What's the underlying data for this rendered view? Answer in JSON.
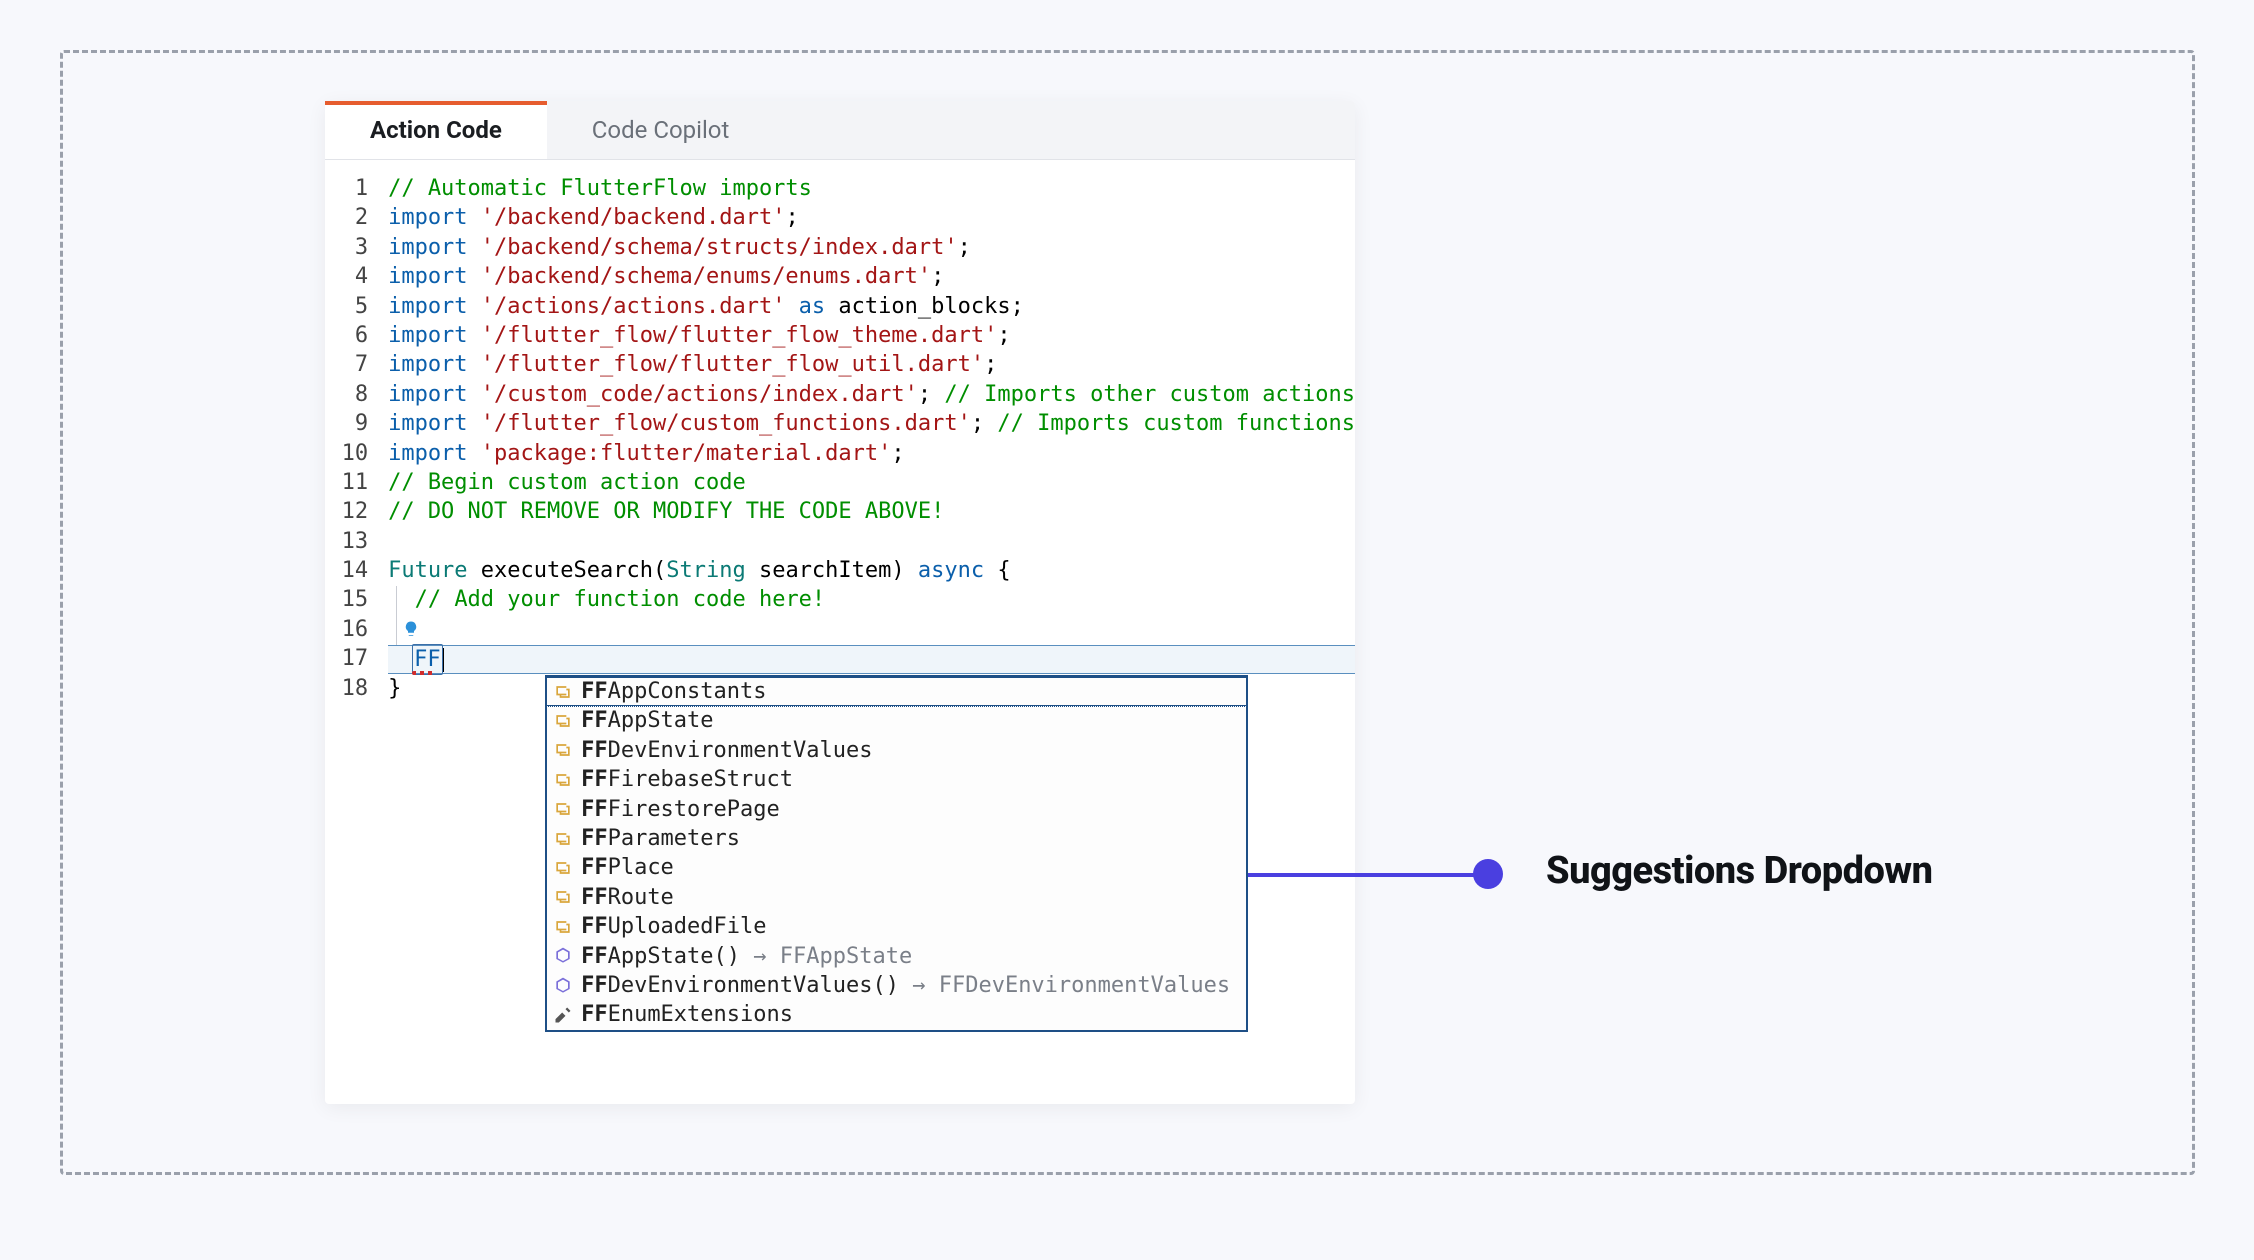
{
  "tabs": {
    "action_code": "Action Code",
    "code_copilot": "Code Copilot"
  },
  "callout": {
    "label": "Suggestions Dropdown"
  },
  "editor": {
    "typed": "FF",
    "lines": [
      {
        "n": "1",
        "segs": [
          {
            "c": "c-com",
            "t": "// Automatic FlutterFlow imports"
          }
        ]
      },
      {
        "n": "2",
        "segs": [
          {
            "c": "c-key",
            "t": "import "
          },
          {
            "c": "c-str",
            "t": "'/backend/backend.dart'"
          },
          {
            "c": "c-pun",
            "t": ";"
          }
        ]
      },
      {
        "n": "3",
        "segs": [
          {
            "c": "c-key",
            "t": "import "
          },
          {
            "c": "c-str",
            "t": "'/backend/schema/structs/index.dart'"
          },
          {
            "c": "c-pun",
            "t": ";"
          }
        ]
      },
      {
        "n": "4",
        "segs": [
          {
            "c": "c-key",
            "t": "import "
          },
          {
            "c": "c-str",
            "t": "'/backend/schema/enums/enums.dart'"
          },
          {
            "c": "c-pun",
            "t": ";"
          }
        ]
      },
      {
        "n": "5",
        "segs": [
          {
            "c": "c-key",
            "t": "import "
          },
          {
            "c": "c-str",
            "t": "'/actions/actions.dart'"
          },
          {
            "c": "c-key",
            "t": " as "
          },
          {
            "c": "c-id",
            "t": "action_blocks"
          },
          {
            "c": "c-pun",
            "t": ";"
          }
        ]
      },
      {
        "n": "6",
        "segs": [
          {
            "c": "c-key",
            "t": "import "
          },
          {
            "c": "c-str",
            "t": "'/flutter_flow/flutter_flow_theme.dart'"
          },
          {
            "c": "c-pun",
            "t": ";"
          }
        ]
      },
      {
        "n": "7",
        "segs": [
          {
            "c": "c-key",
            "t": "import "
          },
          {
            "c": "c-str",
            "t": "'/flutter_flow/flutter_flow_util.dart'"
          },
          {
            "c": "c-pun",
            "t": ";"
          }
        ]
      },
      {
        "n": "8",
        "segs": [
          {
            "c": "c-key",
            "t": "import "
          },
          {
            "c": "c-str",
            "t": "'/custom_code/actions/index.dart'"
          },
          {
            "c": "c-pun",
            "t": "; "
          },
          {
            "c": "c-com",
            "t": "// Imports other custom actions"
          }
        ]
      },
      {
        "n": "9",
        "segs": [
          {
            "c": "c-key",
            "t": "import "
          },
          {
            "c": "c-str",
            "t": "'/flutter_flow/custom_functions.dart'"
          },
          {
            "c": "c-pun",
            "t": "; "
          },
          {
            "c": "c-com",
            "t": "// Imports custom functions"
          }
        ]
      },
      {
        "n": "10",
        "segs": [
          {
            "c": "c-key",
            "t": "import "
          },
          {
            "c": "c-str",
            "t": "'package:flutter/material.dart'"
          },
          {
            "c": "c-pun",
            "t": ";"
          }
        ]
      },
      {
        "n": "11",
        "segs": [
          {
            "c": "c-com",
            "t": "// Begin custom action code"
          }
        ]
      },
      {
        "n": "12",
        "segs": [
          {
            "c": "c-com",
            "t": "// DO NOT REMOVE OR MODIFY THE CODE ABOVE!"
          }
        ]
      },
      {
        "n": "13",
        "segs": [
          {
            "c": "c-id",
            "t": ""
          }
        ]
      },
      {
        "n": "14",
        "segs": [
          {
            "c": "c-typ",
            "t": "Future "
          },
          {
            "c": "c-id",
            "t": "executeSearch("
          },
          {
            "c": "c-typ",
            "t": "String "
          },
          {
            "c": "c-id",
            "t": "searchItem) "
          },
          {
            "c": "c-mod",
            "t": "async "
          },
          {
            "c": "c-pun",
            "t": "{"
          }
        ]
      },
      {
        "n": "15",
        "segs": [
          {
            "c": "c-id",
            "t": "  "
          },
          {
            "c": "c-com",
            "t": "// Add your function code here!"
          }
        ]
      },
      {
        "n": "16",
        "segs": [
          {
            "c": "c-id",
            "t": ""
          }
        ]
      },
      {
        "n": "17",
        "segs": [
          {
            "c": "c-id",
            "t": ""
          }
        ]
      },
      {
        "n": "18",
        "segs": [
          {
            "c": "c-pun",
            "t": "}"
          }
        ]
      }
    ]
  },
  "suggestions": [
    {
      "icon": "class",
      "bold": "FF",
      "rest": "AppConstants",
      "hint": ""
    },
    {
      "icon": "class",
      "bold": "FF",
      "rest": "AppState",
      "hint": ""
    },
    {
      "icon": "class",
      "bold": "FF",
      "rest": "DevEnvironmentValues",
      "hint": ""
    },
    {
      "icon": "class",
      "bold": "FF",
      "rest": "FirebaseStruct",
      "hint": ""
    },
    {
      "icon": "class",
      "bold": "FF",
      "rest": "FirestorePage",
      "hint": ""
    },
    {
      "icon": "class",
      "bold": "FF",
      "rest": "Parameters",
      "hint": ""
    },
    {
      "icon": "class",
      "bold": "FF",
      "rest": "Place",
      "hint": ""
    },
    {
      "icon": "class",
      "bold": "FF",
      "rest": "Route",
      "hint": ""
    },
    {
      "icon": "class",
      "bold": "FF",
      "rest": "UploadedFile",
      "hint": ""
    },
    {
      "icon": "method",
      "bold": "FF",
      "rest": "AppState()",
      "hint": " → FFAppState"
    },
    {
      "icon": "method",
      "bold": "FF",
      "rest": "DevEnvironmentValues()",
      "hint": " → FFDevEnvironmentValues"
    },
    {
      "icon": "wrench",
      "bold": "FF",
      "rest": "EnumExtensions",
      "hint": ""
    }
  ]
}
